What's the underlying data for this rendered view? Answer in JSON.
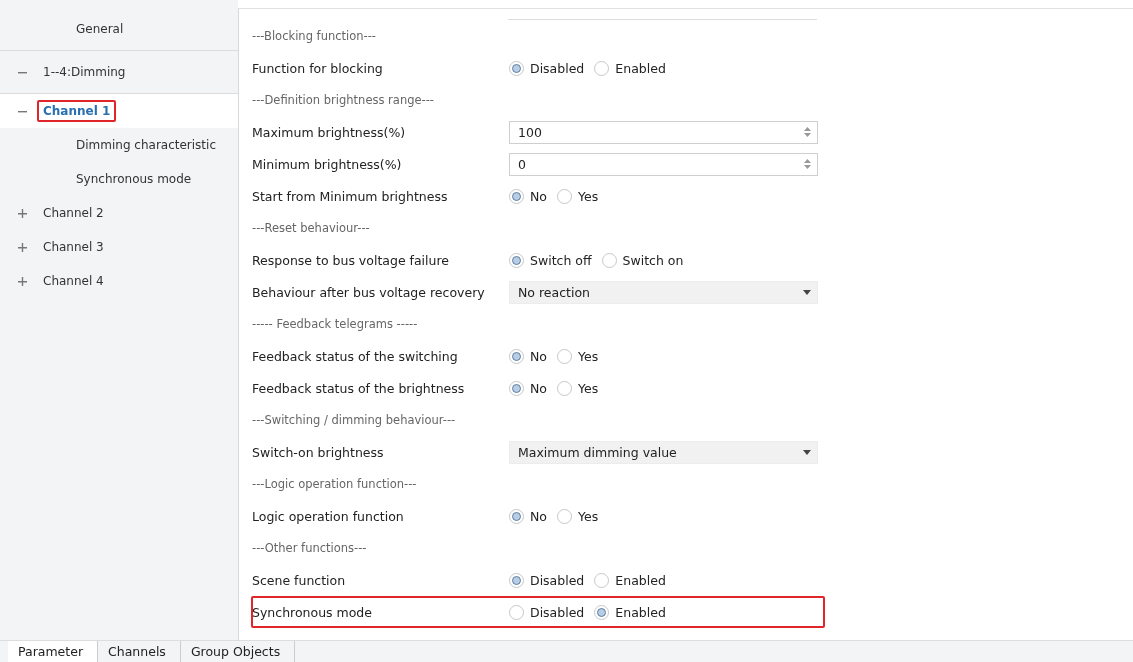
{
  "sidebar": {
    "items": [
      {
        "label": "General",
        "selected": false
      },
      {
        "label": "1--4:Dimming",
        "selected": false,
        "expanded": true,
        "children": [
          {
            "label": "Channel 1",
            "selected": true,
            "expanded": true,
            "highlighted": true,
            "children": [
              {
                "label": "Dimming characteristic",
                "selected": false
              },
              {
                "label": "Synchronous mode",
                "selected": false
              }
            ]
          },
          {
            "label": "Channel 2",
            "selected": false,
            "expanded": false
          },
          {
            "label": "Channel 3",
            "selected": false,
            "expanded": false
          },
          {
            "label": "Channel 4",
            "selected": false,
            "expanded": false
          }
        ]
      }
    ]
  },
  "parameters": [
    {
      "kind": "heading",
      "label": "---Blocking function---"
    },
    {
      "kind": "radio",
      "label": "Function for blocking",
      "options": [
        {
          "label": "Disabled",
          "selected": true
        },
        {
          "label": "Enabled",
          "selected": false
        }
      ]
    },
    {
      "kind": "heading",
      "label": "---Definition brightness range---"
    },
    {
      "kind": "spin",
      "label": "Maximum brightness(%)",
      "value": "100"
    },
    {
      "kind": "spin",
      "label": "Minimum brightness(%)",
      "value": "0"
    },
    {
      "kind": "radio",
      "label": "Start from Minimum brightness",
      "options": [
        {
          "label": "No",
          "selected": true
        },
        {
          "label": "Yes",
          "selected": false
        }
      ]
    },
    {
      "kind": "heading",
      "label": "---Reset behaviour---"
    },
    {
      "kind": "radio",
      "label": "Response to bus voltage failure",
      "options": [
        {
          "label": "Switch off",
          "selected": true
        },
        {
          "label": "Switch on",
          "selected": false
        }
      ]
    },
    {
      "kind": "select",
      "label": "Behaviour after bus voltage recovery",
      "value": "No reaction"
    },
    {
      "kind": "heading",
      "label": "----- Feedback telegrams -----"
    },
    {
      "kind": "radio",
      "label": "Feedback status of the switching",
      "options": [
        {
          "label": "No",
          "selected": true
        },
        {
          "label": "Yes",
          "selected": false
        }
      ]
    },
    {
      "kind": "radio",
      "label": "Feedback status of the brightness",
      "options": [
        {
          "label": "No",
          "selected": true
        },
        {
          "label": "Yes",
          "selected": false
        }
      ]
    },
    {
      "kind": "heading",
      "label": "---Switching / dimming behaviour---"
    },
    {
      "kind": "select",
      "label": "Switch-on brightness",
      "value": "Maximum dimming value"
    },
    {
      "kind": "heading",
      "label": "---Logic operation function---"
    },
    {
      "kind": "radio",
      "label": "Logic operation function",
      "options": [
        {
          "label": "No",
          "selected": true
        },
        {
          "label": "Yes",
          "selected": false
        }
      ]
    },
    {
      "kind": "heading",
      "label": "---Other functions---"
    },
    {
      "kind": "radio",
      "label": "Scene function",
      "options": [
        {
          "label": "Disabled",
          "selected": true
        },
        {
          "label": "Enabled",
          "selected": false
        }
      ]
    },
    {
      "kind": "radio",
      "label": "Synchronous mode",
      "highlighted": true,
      "options": [
        {
          "label": "Disabled",
          "selected": false
        },
        {
          "label": "Enabled",
          "selected": true
        }
      ]
    }
  ],
  "tabs": [
    {
      "label": "Parameter",
      "selected": true
    },
    {
      "label": "Channels",
      "selected": false
    },
    {
      "label": "Group Objects",
      "selected": false
    }
  ]
}
